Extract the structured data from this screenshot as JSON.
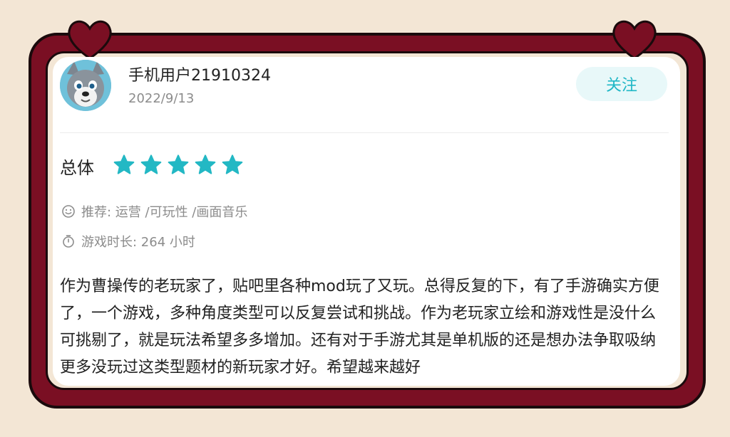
{
  "review": {
    "username": "手机用户21910324",
    "date": "2022/9/13",
    "follow_label": "关注",
    "overall_label": "总体",
    "rating": 5,
    "recommend_text": "推荐: 运营 /可玩性 /画面音乐",
    "playtime_text": "游戏时长: 264 小时",
    "content": "作为曹操传的老玩家了，贴吧里各种mod玩了又玩。总得反复的下，有了手游确实方便了，一个游戏，多种角度类型可以反复尝试和挑战。作为老玩家立绘和游戏性是没什么可挑剔了，就是玩法希望多多增加。还有对于手游尤其是单机版的还是想办法争取吸纳更多没玩过这类型题材的新玩家才好。希望越来越好"
  },
  "colors": {
    "frame": "#7a0f23",
    "background": "#f3e6d5",
    "accent": "#20b7c6",
    "star": "#23b8c4"
  },
  "icons": [
    "heart-icon",
    "star-icon",
    "smile-icon",
    "stopwatch-icon",
    "wolf-avatar"
  ]
}
